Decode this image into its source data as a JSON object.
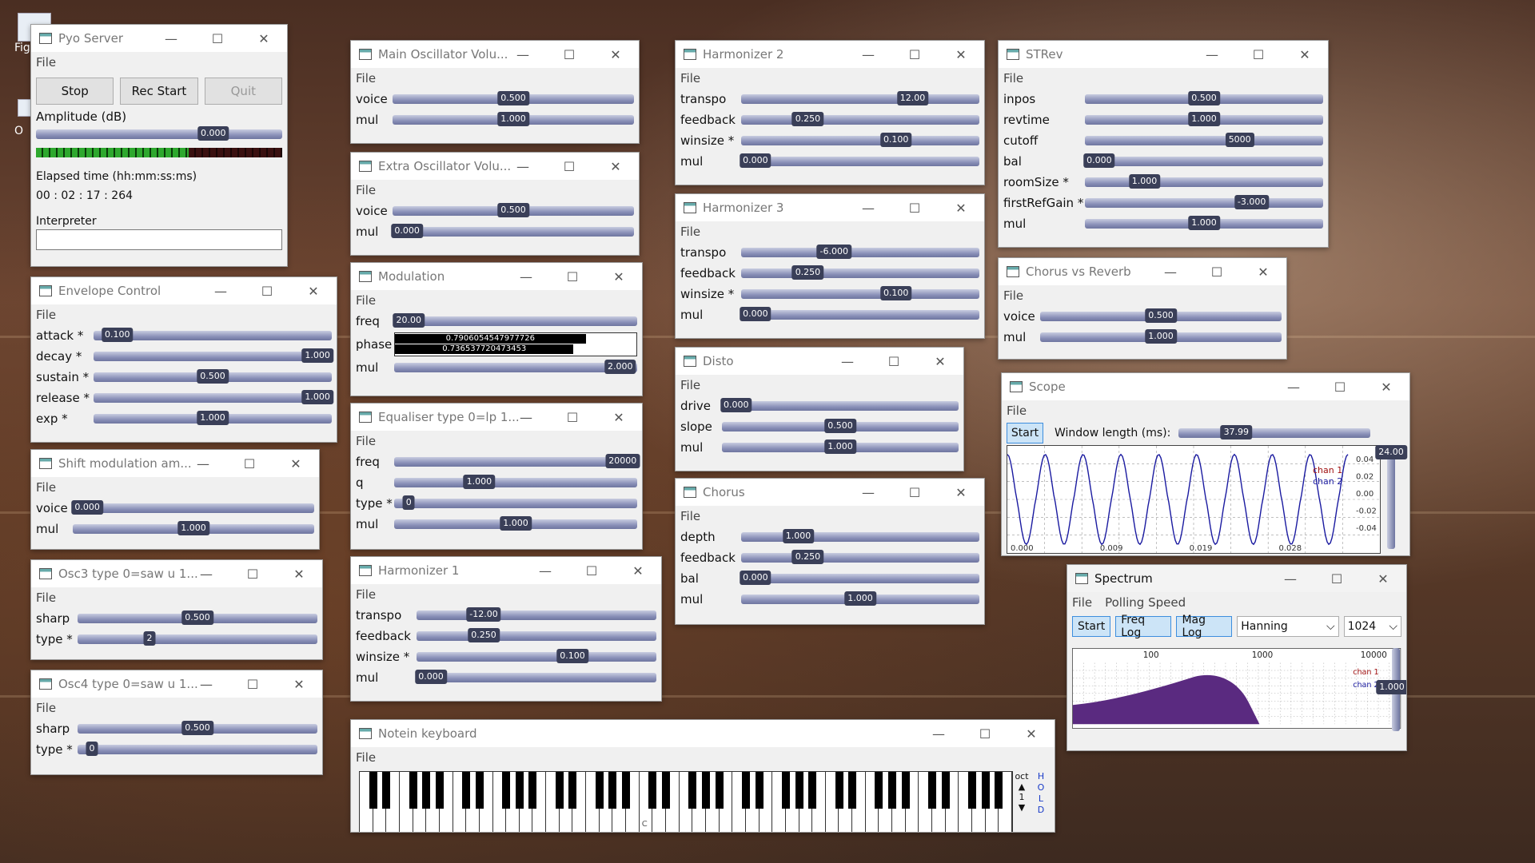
{
  "desktop": {
    "icon1_label": "Fig",
    "icon2_label": "O"
  },
  "pyo_server": {
    "title": "Pyo Server",
    "menu": "File",
    "stop": "Stop",
    "rec_start": "Rec Start",
    "quit": "Quit",
    "amplitude_label": "Amplitude (dB)",
    "amplitude_value": "0.000",
    "elapsed_label": "Elapsed time (hh:mm:ss:ms)",
    "elapsed_value": "00 : 02 : 17 : 264",
    "interpreter_label": "Interpreter"
  },
  "windows": {
    "envelope": {
      "title": "Envelope Control",
      "menu": "File",
      "rows": [
        {
          "label": "attack *",
          "value": "0.100",
          "pos": 0.1
        },
        {
          "label": "decay *",
          "value": "1.000",
          "pos": 0.95
        },
        {
          "label": "sustain *",
          "value": "0.500",
          "pos": 0.5
        },
        {
          "label": "release *",
          "value": "1.000",
          "pos": 0.95
        },
        {
          "label": "exp *",
          "value": "1.000",
          "pos": 0.5
        }
      ]
    },
    "shiftmod": {
      "title": "Shift modulation am...",
      "menu": "File",
      "rows": [
        {
          "label": "voice",
          "value": "0.000",
          "pos": 0.03
        },
        {
          "label": "mul",
          "value": "1.000",
          "pos": 0.5
        }
      ]
    },
    "osc3": {
      "title": "Osc3 type 0=saw u 1...",
      "menu": "File",
      "rows": [
        {
          "label": "sharp",
          "value": "0.500",
          "pos": 0.5
        },
        {
          "label": "type *",
          "value": "2",
          "pos": 0.3
        }
      ]
    },
    "osc4": {
      "title": "Osc4 type 0=saw u 1...",
      "menu": "File",
      "rows": [
        {
          "label": "sharp",
          "value": "0.500",
          "pos": 0.5
        },
        {
          "label": "type *",
          "value": "0",
          "pos": 0.03
        }
      ]
    },
    "mainosc": {
      "title": "Main Oscillator Volu...",
      "menu": "File",
      "rows": [
        {
          "label": "voice",
          "value": "0.500",
          "pos": 0.5
        },
        {
          "label": "mul",
          "value": "1.000",
          "pos": 0.5
        }
      ]
    },
    "extraosc": {
      "title": "Extra Oscillator Volu...",
      "menu": "File",
      "rows": [
        {
          "label": "voice",
          "value": "0.500",
          "pos": 0.5
        },
        {
          "label": "mul",
          "value": "0.000",
          "pos": 0.03
        }
      ]
    },
    "modulation": {
      "title": "Modulation",
      "menu": "File",
      "rows": [
        {
          "label": "freq",
          "value": "20.00",
          "pos": 0.03
        },
        {
          "label": "mul",
          "value": "2.000",
          "pos": 0.95
        }
      ],
      "phase_label": "phase",
      "phase_value1": "0.7906054547977726",
      "phase_value2": "0.736537720473453",
      "phase_fill1": 0.79,
      "phase_fill2": 0.74
    },
    "equaliser": {
      "title": "Equaliser type 0=lp 1...",
      "menu": "File",
      "rows": [
        {
          "label": "freq",
          "value": "20000",
          "pos": 0.95
        },
        {
          "label": "q",
          "value": "1.000",
          "pos": 0.35
        },
        {
          "label": "type *",
          "value": "0",
          "pos": 0.03
        },
        {
          "label": "mul",
          "value": "1.000",
          "pos": 0.5
        }
      ]
    },
    "harm1": {
      "title": "Harmonizer 1",
      "menu": "File",
      "rows": [
        {
          "label": "transpo",
          "value": "-12.00",
          "pos": 0.28
        },
        {
          "label": "feedback",
          "value": "0.250",
          "pos": 0.28
        },
        {
          "label": "winsize *",
          "value": "0.100",
          "pos": 0.65
        },
        {
          "label": "mul",
          "value": "0.000",
          "pos": 0.03
        }
      ]
    },
    "harm2": {
      "title": "Harmonizer 2",
      "menu": "File",
      "rows": [
        {
          "label": "transpo",
          "value": "12.00",
          "pos": 0.72
        },
        {
          "label": "feedback",
          "value": "0.250",
          "pos": 0.28
        },
        {
          "label": "winsize *",
          "value": "0.100",
          "pos": 0.65
        },
        {
          "label": "mul",
          "value": "0.000",
          "pos": 0.03
        }
      ]
    },
    "harm3": {
      "title": "Harmonizer 3",
      "menu": "File",
      "rows": [
        {
          "label": "transpo",
          "value": "-6.000",
          "pos": 0.39
        },
        {
          "label": "feedback",
          "value": "0.250",
          "pos": 0.28
        },
        {
          "label": "winsize *",
          "value": "0.100",
          "pos": 0.65
        },
        {
          "label": "mul",
          "value": "0.000",
          "pos": 0.03
        }
      ]
    },
    "disto": {
      "title": "Disto",
      "menu": "File",
      "rows": [
        {
          "label": "drive",
          "value": "0.000",
          "pos": 0.03
        },
        {
          "label": "slope",
          "value": "0.500",
          "pos": 0.5
        },
        {
          "label": "mul",
          "value": "1.000",
          "pos": 0.5
        }
      ]
    },
    "chorus": {
      "title": "Chorus",
      "menu": "File",
      "rows": [
        {
          "label": "depth",
          "value": "1.000",
          "pos": 0.24
        },
        {
          "label": "feedback",
          "value": "0.250",
          "pos": 0.28
        },
        {
          "label": "bal",
          "value": "0.000",
          "pos": 0.03
        },
        {
          "label": "mul",
          "value": "1.000",
          "pos": 0.5
        }
      ]
    },
    "strev": {
      "title": "STRev",
      "menu": "File",
      "rows": [
        {
          "label": "inpos",
          "value": "0.500",
          "pos": 0.5
        },
        {
          "label": "revtime",
          "value": "1.000",
          "pos": 0.5
        },
        {
          "label": "cutoff",
          "value": "5000",
          "pos": 0.65
        },
        {
          "label": "bal",
          "value": "0.000",
          "pos": 0.03
        },
        {
          "label": "roomSize *",
          "value": "1.000",
          "pos": 0.25
        },
        {
          "label": "firstRefGain *",
          "value": "-3.000",
          "pos": 0.7
        },
        {
          "label": "mul",
          "value": "1.000",
          "pos": 0.5
        }
      ]
    },
    "chorusrev": {
      "title": "Chorus vs Reverb",
      "menu": "File",
      "rows": [
        {
          "label": "voice",
          "value": "0.500",
          "pos": 0.5
        },
        {
          "label": "mul",
          "value": "1.000",
          "pos": 0.5
        }
      ]
    }
  },
  "scope": {
    "title": "Scope",
    "menu": "File",
    "start": "Start",
    "window_label": "Window length (ms):",
    "window_value": "37.99",
    "gain_value": "24.00",
    "x_ticks": [
      "0.000",
      "0.009",
      "0.019",
      "0.028"
    ],
    "y_ticks": [
      "0.04",
      "0.02",
      "0.00",
      "-0.02",
      "-0.04"
    ],
    "legend": [
      "chan 1",
      "chan 2"
    ],
    "cycles": 9
  },
  "spectrum": {
    "title": "Spectrum",
    "menu": [
      "File",
      "Polling Speed"
    ],
    "start": "Start",
    "freq_log": "Freq Log",
    "mag_log": "Mag Log",
    "window_select": "Hanning",
    "size_select": "1024",
    "x_ticks": [
      "100",
      "1000",
      "10000"
    ],
    "legend": [
      "chan 1",
      "chan 2"
    ],
    "gain_value": "1.000"
  },
  "keyboard": {
    "title": "Notein keyboard",
    "menu": "File",
    "oct_label": "oct",
    "oct_value": "1",
    "hold": "HOLD",
    "c_label": "C"
  },
  "colors": {
    "accent": "#3a3f58",
    "wave": "#1a1aa0",
    "spectrum_fill": "#5a2a80"
  }
}
